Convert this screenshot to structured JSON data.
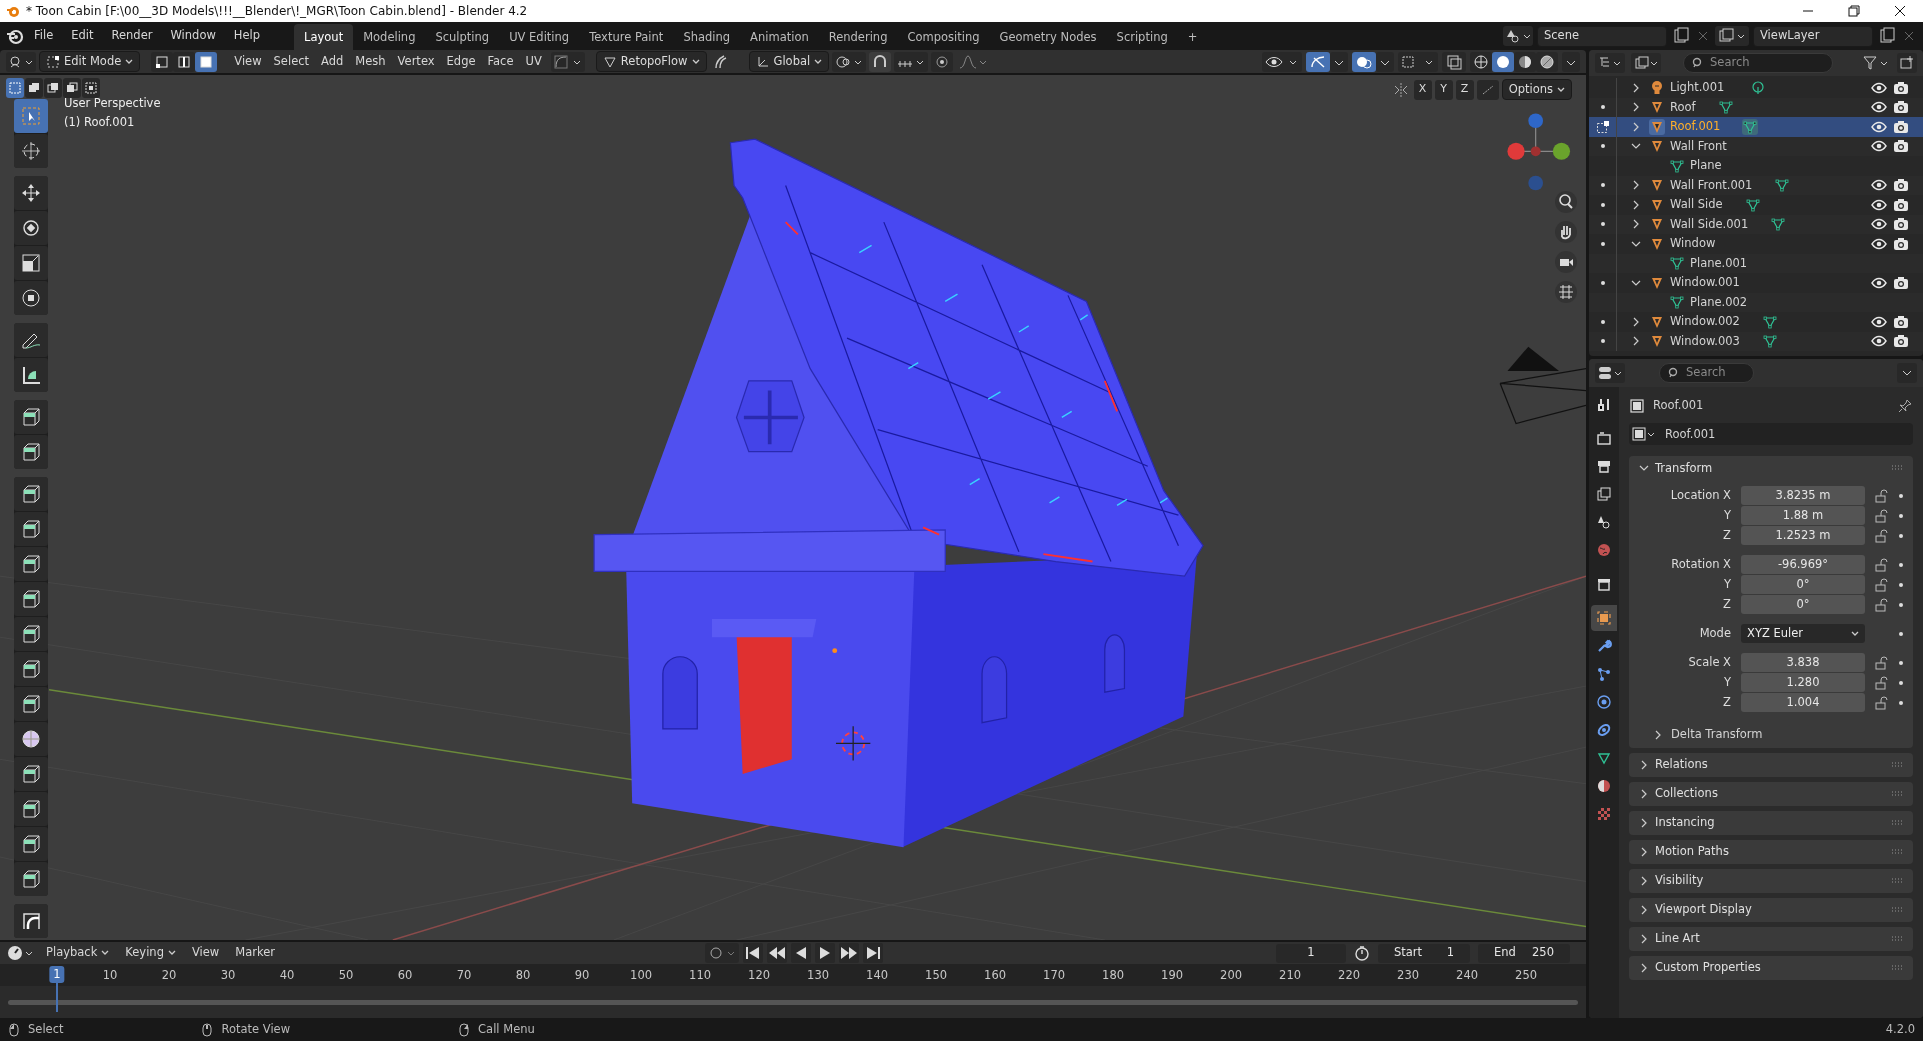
{
  "window": {
    "title": "* Toon Cabin [F:\\00__3D Models\\!!!__Blender\\!_MGR\\Toon Cabin.blend] - Blender 4.2"
  },
  "menu": [
    "File",
    "Edit",
    "Render",
    "Window",
    "Help"
  ],
  "workspaces": [
    {
      "label": "Layout",
      "selected": true
    },
    {
      "label": "Modeling",
      "selected": false
    },
    {
      "label": "Sculpting",
      "selected": false
    },
    {
      "label": "UV Editing",
      "selected": false
    },
    {
      "label": "Texture Paint",
      "selected": false
    },
    {
      "label": "Shading",
      "selected": false
    },
    {
      "label": "Animation",
      "selected": false
    },
    {
      "label": "Rendering",
      "selected": false
    },
    {
      "label": "Compositing",
      "selected": false
    },
    {
      "label": "Geometry Nodes",
      "selected": false
    },
    {
      "label": "Scripting",
      "selected": false
    }
  ],
  "add_workspace": "+",
  "scene": "Scene",
  "view_layer": "ViewLayer",
  "viewport_header": {
    "mode": "Edit Mode",
    "select_modes": [
      {
        "kind": "vertex",
        "selected": false
      },
      {
        "kind": "edge",
        "selected": false
      },
      {
        "kind": "face",
        "selected": true
      }
    ],
    "menus": [
      "View",
      "Select",
      "Add",
      "Mesh",
      "Vertex",
      "Edge",
      "Face",
      "UV"
    ],
    "addon": "RetopoFlow",
    "orientation": "Global",
    "gizmos_on": true,
    "overlays_on": true,
    "shading": [
      {
        "kind": "wireframe",
        "selected": false
      },
      {
        "kind": "solid",
        "selected": true
      },
      {
        "kind": "material",
        "selected": false
      },
      {
        "kind": "rendered",
        "selected": false
      }
    ]
  },
  "viewport": {
    "select_ops": [
      {
        "kind": "new",
        "selected": true
      },
      {
        "kind": "extend",
        "selected": false
      },
      {
        "kind": "subtract",
        "selected": false
      },
      {
        "kind": "invert",
        "selected": false
      },
      {
        "kind": "intersect",
        "selected": false
      }
    ],
    "mirror_axes": [
      "X",
      "Y",
      "Z"
    ],
    "options": "Options",
    "perspective": "User Perspective",
    "object": "(1) Roof.001"
  },
  "tools": [
    [
      {
        "kind": "select",
        "selected": true
      },
      {
        "kind": "cursor",
        "selected": false
      }
    ],
    [
      {
        "kind": "move",
        "selected": false
      },
      {
        "kind": "rotate",
        "selected": false
      },
      {
        "kind": "scale",
        "selected": false
      },
      {
        "kind": "transform",
        "selected": false
      }
    ],
    [
      {
        "kind": "annotate",
        "selected": false
      },
      {
        "kind": "measure",
        "selected": false
      }
    ],
    [
      {
        "kind": "cube",
        "selected": false
      },
      {
        "kind": "cube",
        "selected": false
      }
    ],
    [
      {
        "kind": "cube",
        "selected": false
      },
      {
        "kind": "cube",
        "selected": false
      },
      {
        "kind": "cube",
        "selected": false
      },
      {
        "kind": "cube",
        "selected": false
      },
      {
        "kind": "cube",
        "selected": false
      },
      {
        "kind": "cube",
        "selected": false
      },
      {
        "kind": "cube",
        "selected": false
      },
      {
        "kind": "sphere",
        "selected": false
      },
      {
        "kind": "cube",
        "selected": false
      },
      {
        "kind": "cube",
        "selected": false
      },
      {
        "kind": "cube",
        "selected": false
      },
      {
        "kind": "cube",
        "selected": false
      }
    ],
    [
      {
        "kind": "curve",
        "selected": false
      }
    ]
  ],
  "outliner": {
    "search_placeholder": "Search",
    "items": [
      {
        "name": "Light.001",
        "kind": "light",
        "mode_dot": false,
        "editing": false,
        "selected": false,
        "expanded": false
      },
      {
        "name": "Roof",
        "kind": "mesh",
        "mode_dot": true,
        "editing": false,
        "selected": false,
        "expanded": false
      },
      {
        "name": "Roof.001",
        "kind": "mesh",
        "mode_dot": false,
        "editing": true,
        "selected": true,
        "expanded": false
      },
      {
        "name": "Wall Front",
        "kind": "empty",
        "mode_dot": true,
        "editing": false,
        "selected": false,
        "expanded": true,
        "children": [
          {
            "name": "Plane",
            "kind": "mesh-data"
          }
        ]
      },
      {
        "name": "Wall Front.001",
        "kind": "mesh",
        "mode_dot": true,
        "editing": false,
        "selected": false,
        "expanded": false
      },
      {
        "name": "Wall Side",
        "kind": "mesh",
        "mode_dot": true,
        "editing": false,
        "selected": false,
        "expanded": false
      },
      {
        "name": "Wall Side.001",
        "kind": "mesh",
        "mode_dot": true,
        "editing": false,
        "selected": false,
        "expanded": false
      },
      {
        "name": "Window",
        "kind": "empty",
        "mode_dot": true,
        "editing": false,
        "selected": false,
        "expanded": true,
        "children": [
          {
            "name": "Plane.001",
            "kind": "mesh-data"
          }
        ]
      },
      {
        "name": "Window.001",
        "kind": "empty",
        "mode_dot": true,
        "editing": false,
        "selected": false,
        "expanded": true,
        "children": [
          {
            "name": "Plane.002",
            "kind": "mesh-data"
          }
        ]
      },
      {
        "name": "Window.002",
        "kind": "mesh",
        "mode_dot": true,
        "editing": false,
        "selected": false,
        "expanded": false
      },
      {
        "name": "Window.003",
        "kind": "mesh",
        "mode_dot": true,
        "editing": false,
        "selected": false,
        "expanded": false
      }
    ]
  },
  "properties": {
    "search_placeholder": "Search",
    "tabs": [
      {
        "kind": "tool",
        "selected": false
      },
      {
        "kind": "render",
        "selected": false
      },
      {
        "kind": "output",
        "selected": false
      },
      {
        "kind": "view-layer",
        "selected": false
      },
      {
        "kind": "scene",
        "selected": false
      },
      {
        "kind": "world",
        "selected": false
      },
      {
        "kind": "collection",
        "selected": false
      },
      {
        "kind": "object",
        "selected": true
      },
      {
        "kind": "modifier",
        "selected": false
      },
      {
        "kind": "particles",
        "selected": false
      },
      {
        "kind": "physics",
        "selected": false
      },
      {
        "kind": "constraint",
        "selected": false
      },
      {
        "kind": "data",
        "selected": false
      },
      {
        "kind": "material",
        "selected": false
      },
      {
        "kind": "texture",
        "selected": false
      }
    ],
    "object_name": "Roof.001",
    "name_field": "Roof.001",
    "transform": {
      "title": "Transform",
      "expanded": true,
      "groups": [
        {
          "kind": "number",
          "rows": [
            {
              "label": "Location X",
              "value": "3.8235 m"
            },
            {
              "label": "Y",
              "value": "1.88 m"
            },
            {
              "label": "Z",
              "value": "1.2523 m"
            }
          ]
        },
        {
          "kind": "number",
          "rows": [
            {
              "label": "Rotation X",
              "value": "-96.969°"
            },
            {
              "label": "Y",
              "value": "0°"
            },
            {
              "label": "Z",
              "value": "0°"
            }
          ]
        },
        {
          "kind": "dropdown",
          "rows": [
            {
              "label": "Mode",
              "value": "XYZ Euler"
            }
          ]
        },
        {
          "kind": "number",
          "rows": [
            {
              "label": "Scale X",
              "value": "3.838"
            },
            {
              "label": "Y",
              "value": "1.280"
            },
            {
              "label": "Z",
              "value": "1.004"
            }
          ]
        }
      ],
      "subpanel": "Delta Transform"
    },
    "panels": [
      "Relations",
      "Collections",
      "Instancing",
      "Motion Paths",
      "Visibility",
      "Viewport Display",
      "Line Art",
      "Custom Properties"
    ]
  },
  "timeline": {
    "menus": [
      "Playback",
      "Keying",
      "View",
      "Marker"
    ],
    "current_frame": "1",
    "start_label": "Start",
    "start": "1",
    "end_label": "End",
    "end": "250",
    "playhead": "1",
    "ticks": [
      "10",
      "20",
      "30",
      "40",
      "50",
      "60",
      "70",
      "80",
      "90",
      "100",
      "110",
      "120",
      "130",
      "140",
      "150",
      "160",
      "170",
      "180",
      "190",
      "200",
      "210",
      "220",
      "230",
      "240",
      "250"
    ]
  },
  "status_bar": {
    "items": [
      "Select",
      "Rotate View",
      "Call Menu"
    ],
    "version": "4.2.0"
  }
}
